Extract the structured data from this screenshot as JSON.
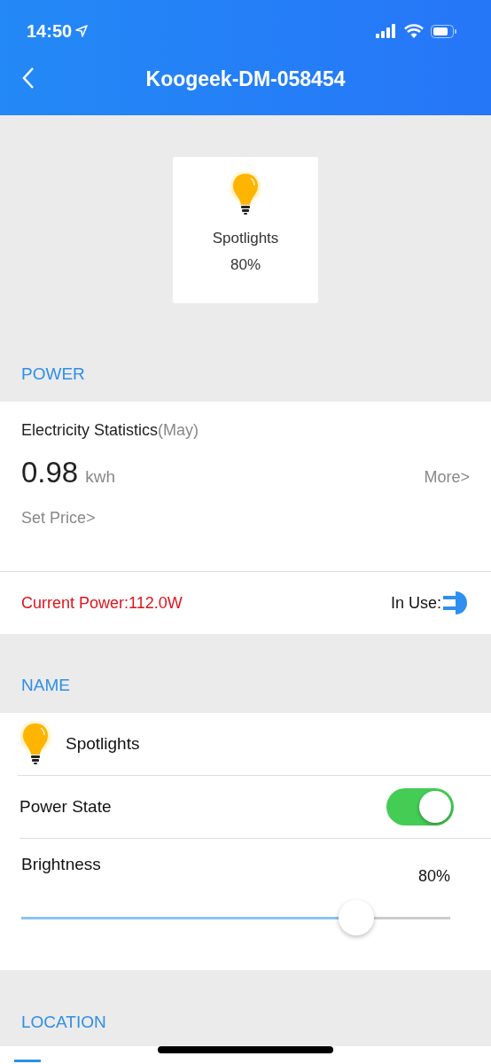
{
  "status_bar": {
    "time": "14:50"
  },
  "header": {
    "title": "Koogeek-DM-058454"
  },
  "device_tile": {
    "name": "Spotlights",
    "reading": "80%"
  },
  "sections": [
    {
      "title": "POWER"
    },
    {
      "title": "NAME"
    },
    {
      "title": "LOCATION"
    }
  ],
  "power": {
    "heading": "Electricity Statistics",
    "period": "(May)",
    "value": "0.98",
    "unit": "kwh",
    "more_link": "More>",
    "set_price_link": "Set Price>",
    "current_power": "Current Power:112.0W",
    "in_use_label": "In Use:",
    "in_use": true
  },
  "name_row": {
    "name": "Spotlights"
  },
  "power_state": {
    "label": "Power State",
    "on": true
  },
  "brightness": {
    "label": "Brightness",
    "reading": "80%",
    "level": 0.78
  }
}
